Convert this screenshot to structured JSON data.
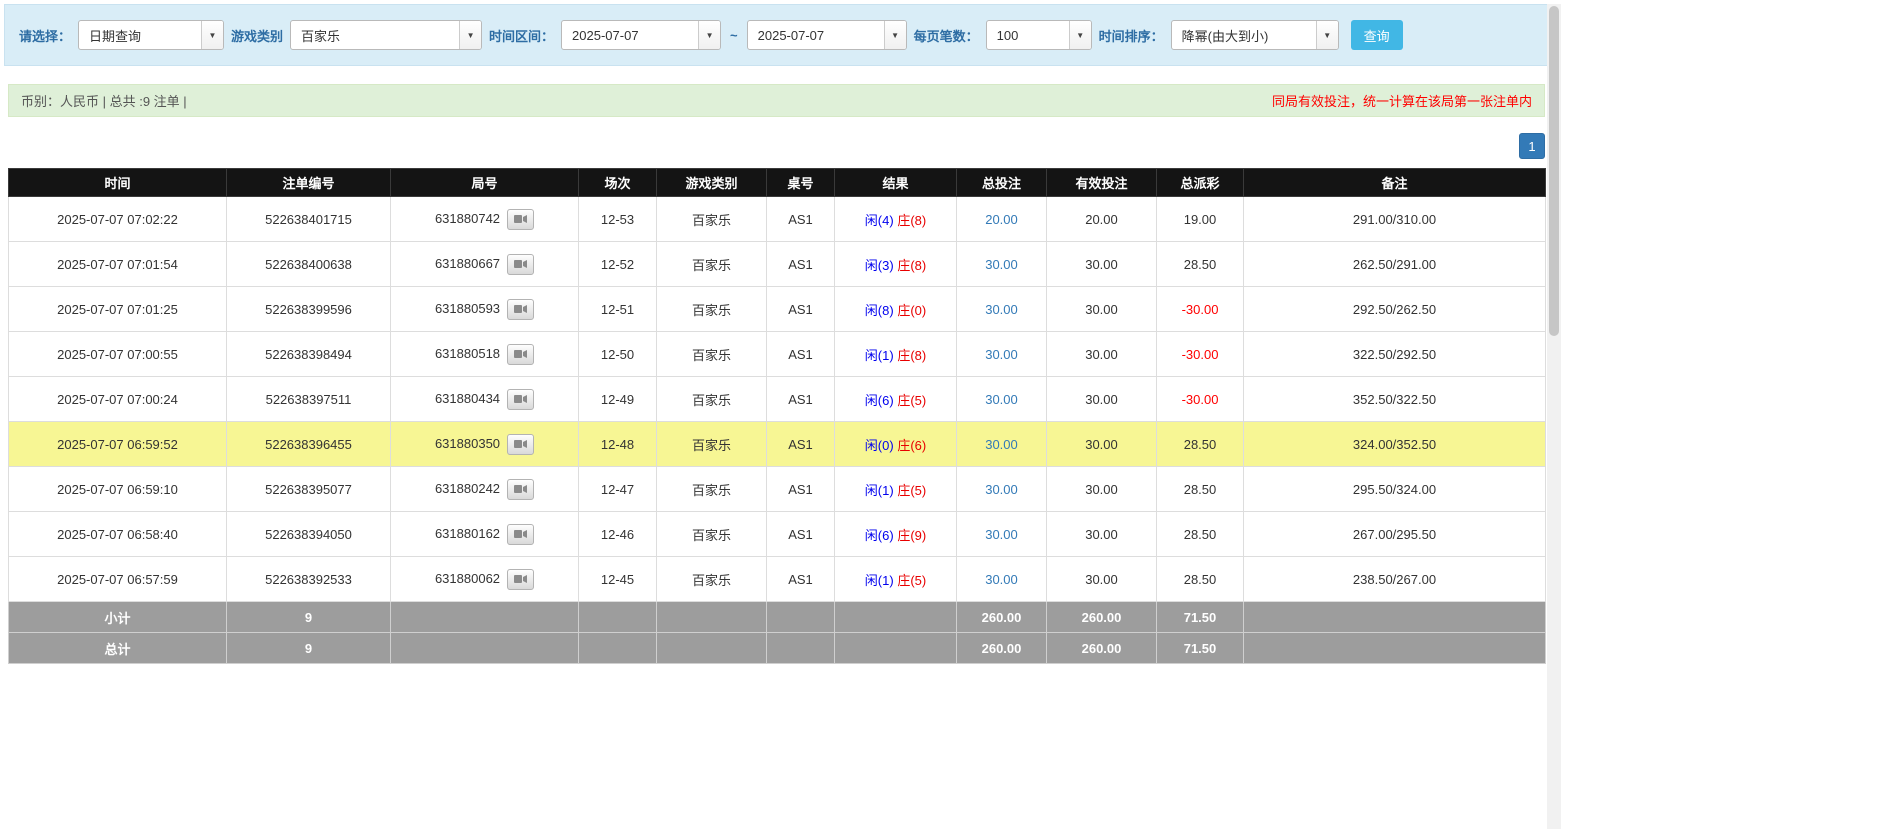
{
  "filters": {
    "select_label": "请选择：",
    "select_value": "日期查询",
    "game_type_label": "游戏类别",
    "game_type_value": "百家乐",
    "time_range_label": "时间区间：",
    "date_from": "2025-07-07",
    "tilde": "~",
    "date_to": "2025-07-07",
    "per_page_label": "每页笔数：",
    "per_page_value": "100",
    "sort_label": "时间排序：",
    "sort_value": "降幂(由大到小)",
    "search_button": "查询"
  },
  "info_bar": {
    "left": "币别：人民币 | 总共 :9 注单 |",
    "right": "同局有效投注，统一计算在该局第一张注单内"
  },
  "pagination": {
    "page": "1"
  },
  "colors": {
    "accent_blue": "#337ab7",
    "player_blue": "#0000ee",
    "banker_red": "#e80000",
    "negative_red": "#ff0000",
    "highlight_yellow": "#f7f694"
  },
  "table": {
    "headers": [
      "时间",
      "注单编号",
      "局号",
      "场次",
      "游戏类别",
      "桌号",
      "结果",
      "总投注",
      "有效投注",
      "总派彩",
      "备注"
    ],
    "rows": [
      {
        "time": "2025-07-07 07:02:22",
        "bet_id": "522638401715",
        "round_id": "631880742",
        "session": "12-53",
        "game": "百家乐",
        "table_no": "AS1",
        "result_player": "闲(4)",
        "result_banker": "庄(8)",
        "total_bet": "20.00",
        "valid_bet": "20.00",
        "payout": "19.00",
        "note": "291.00/310.00",
        "highlight": false
      },
      {
        "time": "2025-07-07 07:01:54",
        "bet_id": "522638400638",
        "round_id": "631880667",
        "session": "12-52",
        "game": "百家乐",
        "table_no": "AS1",
        "result_player": "闲(3)",
        "result_banker": "庄(8)",
        "total_bet": "30.00",
        "valid_bet": "30.00",
        "payout": "28.50",
        "note": "262.50/291.00",
        "highlight": false
      },
      {
        "time": "2025-07-07 07:01:25",
        "bet_id": "522638399596",
        "round_id": "631880593",
        "session": "12-51",
        "game": "百家乐",
        "table_no": "AS1",
        "result_player": "闲(8)",
        "result_banker": "庄(0)",
        "total_bet": "30.00",
        "valid_bet": "30.00",
        "payout": "-30.00",
        "note": "292.50/262.50",
        "highlight": false
      },
      {
        "time": "2025-07-07 07:00:55",
        "bet_id": "522638398494",
        "round_id": "631880518",
        "session": "12-50",
        "game": "百家乐",
        "table_no": "AS1",
        "result_player": "闲(1)",
        "result_banker": "庄(8)",
        "total_bet": "30.00",
        "valid_bet": "30.00",
        "payout": "-30.00",
        "note": "322.50/292.50",
        "highlight": false
      },
      {
        "time": "2025-07-07 07:00:24",
        "bet_id": "522638397511",
        "round_id": "631880434",
        "session": "12-49",
        "game": "百家乐",
        "table_no": "AS1",
        "result_player": "闲(6)",
        "result_banker": "庄(5)",
        "total_bet": "30.00",
        "valid_bet": "30.00",
        "payout": "-30.00",
        "note": "352.50/322.50",
        "highlight": false
      },
      {
        "time": "2025-07-07 06:59:52",
        "bet_id": "522638396455",
        "round_id": "631880350",
        "session": "12-48",
        "game": "百家乐",
        "table_no": "AS1",
        "result_player": "闲(0)",
        "result_banker": "庄(6)",
        "total_bet": "30.00",
        "valid_bet": "30.00",
        "payout": "28.50",
        "note": "324.00/352.50",
        "highlight": true
      },
      {
        "time": "2025-07-07 06:59:10",
        "bet_id": "522638395077",
        "round_id": "631880242",
        "session": "12-47",
        "game": "百家乐",
        "table_no": "AS1",
        "result_player": "闲(1)",
        "result_banker": "庄(5)",
        "total_bet": "30.00",
        "valid_bet": "30.00",
        "payout": "28.50",
        "note": "295.50/324.00",
        "highlight": false
      },
      {
        "time": "2025-07-07 06:58:40",
        "bet_id": "522638394050",
        "round_id": "631880162",
        "session": "12-46",
        "game": "百家乐",
        "table_no": "AS1",
        "result_player": "闲(6)",
        "result_banker": "庄(9)",
        "total_bet": "30.00",
        "valid_bet": "30.00",
        "payout": "28.50",
        "note": "267.00/295.50",
        "highlight": false
      },
      {
        "time": "2025-07-07 06:57:59",
        "bet_id": "522638392533",
        "round_id": "631880062",
        "session": "12-45",
        "game": "百家乐",
        "table_no": "AS1",
        "result_player": "闲(1)",
        "result_banker": "庄(5)",
        "total_bet": "30.00",
        "valid_bet": "30.00",
        "payout": "28.50",
        "note": "238.50/267.00",
        "highlight": false
      }
    ],
    "footer": [
      {
        "label": "小计",
        "count": "9",
        "total_bet": "260.00",
        "valid_bet": "260.00",
        "payout": "71.50"
      },
      {
        "label": "总计",
        "count": "9",
        "total_bet": "260.00",
        "valid_bet": "260.00",
        "payout": "71.50"
      }
    ]
  }
}
